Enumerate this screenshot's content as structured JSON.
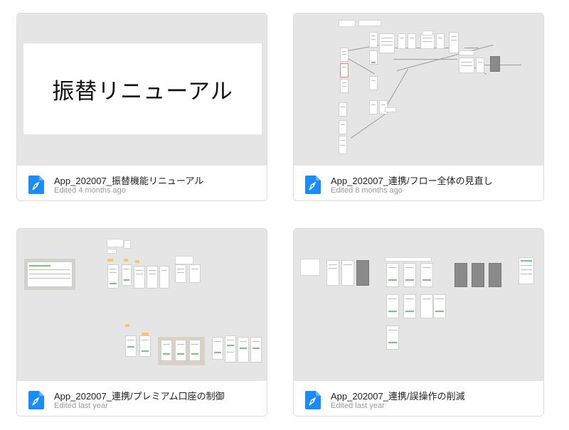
{
  "files": [
    {
      "title": "App_202007_振替機能リニューアル",
      "edited": "Edited 4 months ago",
      "thumbnail_text": "振替リニューアル"
    },
    {
      "title": "App_202007_連携/フロー全体の見直し",
      "edited": "Edited 8 months ago"
    },
    {
      "title": "App_202007_連携/プレミアム口座の制御",
      "edited": "Edited last year"
    },
    {
      "title": "App_202007_連携/誤操作の削減",
      "edited": "Edited last year"
    }
  ],
  "colors": {
    "icon_blue": "#1a8cff",
    "thumb_bg": "#e5e5e5",
    "accent_green": "#6bd06b"
  },
  "icon": "figma-file-icon"
}
